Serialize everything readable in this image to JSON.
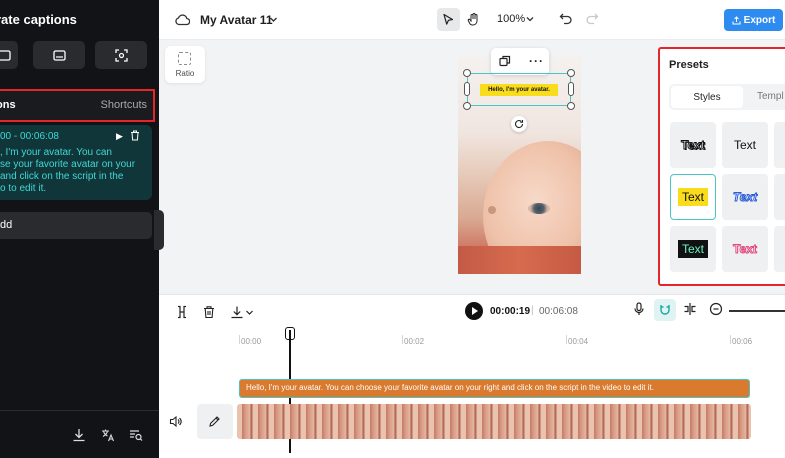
{
  "left_panel": {
    "title": "rate captions",
    "tabs": {
      "active": "ons",
      "secondary": "Shortcuts"
    },
    "caption": {
      "time": "00 - 00:06:08",
      "text": ", I'm your avatar. You can\nse your favorite avatar on your\nand click on the script in the\no to edit it."
    },
    "add_label": "dd"
  },
  "topbar": {
    "project_name": "My Avatar 11",
    "zoom": "100%",
    "export_label": "Export"
  },
  "canvas": {
    "ratio_label": "Ratio",
    "overlay_caption": "Hello, I'm your avatar."
  },
  "presets": {
    "title": "Presets",
    "tabs": [
      "Styles",
      "Templ"
    ],
    "items": [
      {
        "label": "Text"
      },
      {
        "label": "Text"
      },
      {
        "label": "Text"
      },
      {
        "label": "Text"
      },
      {
        "label": "Text"
      },
      {
        "label": "Text"
      }
    ]
  },
  "timeline": {
    "current_time": "00:00:19",
    "separator": "|",
    "total_time": "00:06:08",
    "ruler": [
      "00:00",
      "00:02",
      "00:04",
      "00:06"
    ],
    "caption_track_text": "Hello, I'm your avatar. You can choose your favorite avatar on your right and click on the script in the video to edit it."
  },
  "colors": {
    "accent": "#2e8bf0",
    "selection": "#4bc4c6",
    "highlight_border": "#e3262b",
    "caption_track": "#d97a2e"
  }
}
